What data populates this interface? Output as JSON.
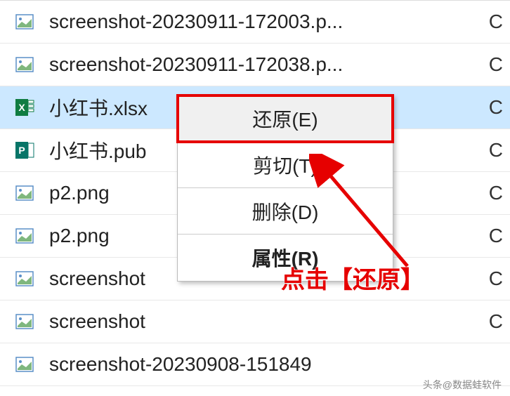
{
  "files": [
    {
      "name": "screenshot-20230911-172003.p...",
      "type": "image",
      "attr": "C"
    },
    {
      "name": "screenshot-20230911-172038.p...",
      "type": "image",
      "attr": "C"
    },
    {
      "name": "小红书.xlsx",
      "type": "excel",
      "attr": "C",
      "selected": true
    },
    {
      "name": "小红书.pub",
      "type": "publisher",
      "attr": "C"
    },
    {
      "name": "p2.png",
      "type": "image",
      "attr": "C"
    },
    {
      "name": "p2.png",
      "type": "image",
      "attr": "C"
    },
    {
      "name": "screenshot",
      "type": "image",
      "attr": "C"
    },
    {
      "name": "screenshot",
      "type": "image",
      "attr": "C"
    },
    {
      "name": "screenshot-20230908-151849",
      "type": "image",
      "attr": ""
    }
  ],
  "context_menu": {
    "items": [
      {
        "label": "还原(E)",
        "highlighted": true
      },
      {
        "label": "剪切(T)"
      },
      {
        "label": "删除(D)"
      },
      {
        "label": "属性(R)",
        "bold": true
      }
    ]
  },
  "annotation": {
    "text": "点击【还原】"
  },
  "watermark": "头条@数据蛙软件"
}
